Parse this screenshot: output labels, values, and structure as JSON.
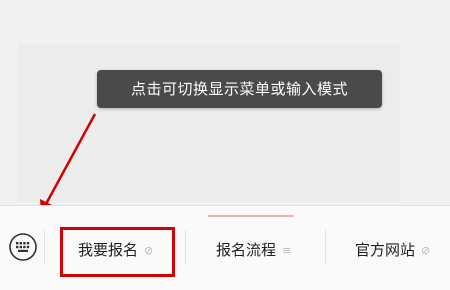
{
  "tooltip": {
    "text": "点击可切换显示菜单或输入模式"
  },
  "menu": {
    "keyboard_icon": "keyboard-icon",
    "items": [
      {
        "label": "我要报名",
        "icon": "link-icon",
        "glyph": "🔗"
      },
      {
        "label": "报名流程",
        "icon": "list-icon",
        "glyph": "≡"
      },
      {
        "label": "官方网站",
        "icon": "link-icon",
        "glyph": "🔗"
      }
    ]
  },
  "annotation": {
    "arrow_color": "#d40000",
    "highlight_color": "#d40000"
  }
}
